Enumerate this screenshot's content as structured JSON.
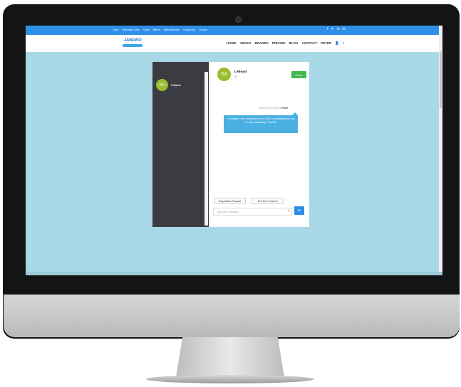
{
  "topbar": {
    "links": [
      "Cars",
      "Manage Cars",
      "Tests",
      "Bikes",
      "Motorhomes",
      "Caravans",
      "Trucks"
    ],
    "social_icons": [
      "f",
      "✦",
      "in",
      "✉"
    ]
  },
  "navbar": {
    "logo_text": "JANDEO",
    "menu": [
      "HOME",
      "ABOUT",
      "BRANDS",
      "PRICING",
      "BLOG",
      "CONTACT",
      "PETER"
    ],
    "user_icon": "👤",
    "heart_icon": "♥"
  },
  "sidebar": {
    "conversation": {
      "initials": "SA",
      "name": "LeBeast",
      "sub": "ID"
    }
  },
  "chat": {
    "header": {
      "initials": "SA",
      "name": "LeBeast",
      "sub": "ID"
    },
    "close_label": "Close",
    "message_meta": "Sent 09:12 on 26.11",
    "message_author": "Peter",
    "message_text": "I'd actually. I am interested in your ADR for availability did you fix, with availability? Thanks!",
    "quick_replies": [
      "Negotiation Request",
      "Test Drive Interest"
    ],
    "input_placeholder": "Type your message",
    "send_icon": "➤",
    "pencil_icon": "✎"
  },
  "colors": {
    "brand_blue": "#2e8fe8",
    "chat_bubble": "#4ab0e4",
    "close_green": "#3fb94f",
    "avatar": "#9bbd2e",
    "background": "#a9d8e6"
  }
}
